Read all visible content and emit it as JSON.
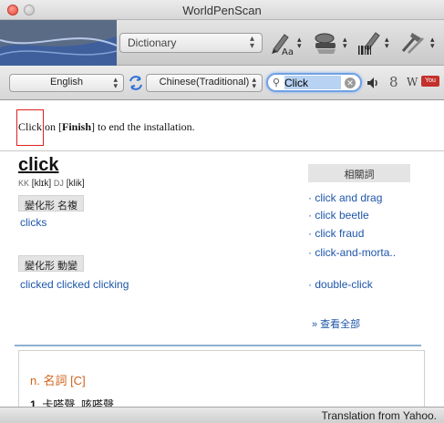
{
  "window": {
    "title": "WorldPenScan"
  },
  "toolbar": {
    "dictionary_select": "Dictionary"
  },
  "langbar": {
    "source_lang": "English",
    "target_lang": "Chinese(Traditional)",
    "search_value": "Click",
    "side_icons": {
      "speaker": "speaker-icon",
      "letter_s": "8",
      "letter_w": "W",
      "youtube": "You"
    }
  },
  "sentence": {
    "text_pre": "Click",
    "text_mid": " on [",
    "text_bold": "Finish",
    "text_post": "] to end the installation."
  },
  "entry": {
    "headword": "click",
    "kk_label": "KK",
    "kk": "[klɪk]",
    "dj_label": "DJ",
    "dj": "[klik]",
    "tag1": "變化形 名複",
    "form1": "clicks",
    "tag2": "變化形 動變",
    "form2": "clicked clicked clicking",
    "pos": "n. 名詞 [C]",
    "def1_num": "1.",
    "def1_text": "卡嗒聲, 咳嗒聲"
  },
  "related": {
    "heading": "相關詞",
    "items": [
      "click and drag",
      "click beetle",
      "click fraud",
      "click-and-morta..",
      "double-click"
    ],
    "more": "» 查看全部"
  },
  "status": {
    "text": "Translation from Yahoo."
  }
}
